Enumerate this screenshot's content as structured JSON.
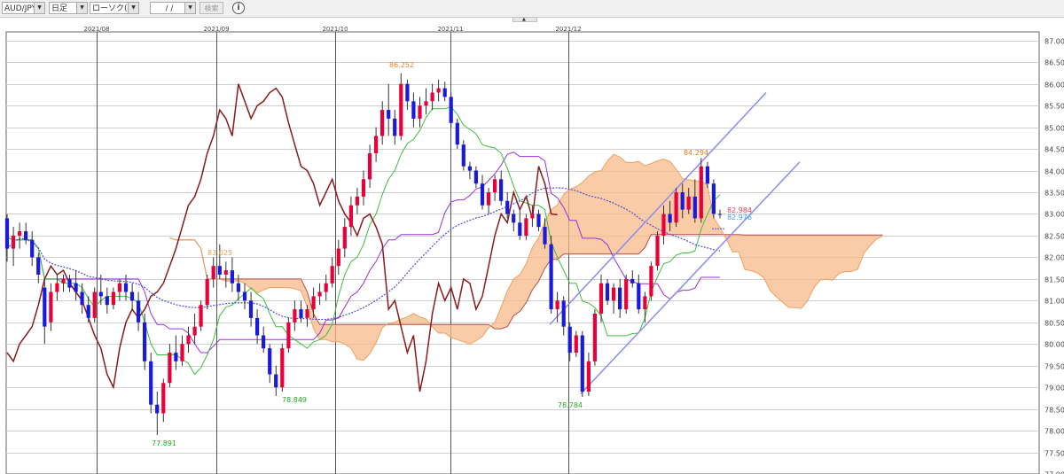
{
  "toolbar": {
    "pair": "AUD/JPY",
    "period": "日足",
    "chart_type": "ローソク(BID)",
    "date": "/ /",
    "search_label": "検索",
    "info_label": "i"
  },
  "chart_data": {
    "type": "candlestick",
    "symbol": "AUD/JPY",
    "ylim": [
      77.0,
      87.2
    ],
    "y_ticks": [
      "77.000",
      "77.500",
      "78.000",
      "78.500",
      "79.000",
      "79.500",
      "80.000",
      "80.500",
      "81.000",
      "81.500",
      "82.000",
      "82.500",
      "83.000",
      "83.500",
      "84.000",
      "84.500",
      "85.000",
      "85.500",
      "86.000",
      "86.500",
      "87.000"
    ],
    "x_months": [
      "2021/08",
      "2021/09",
      "2021/10",
      "2021/11",
      "2021/12"
    ],
    "grid": true,
    "price_labels": {
      "bid": "82.984",
      "ask": "82.976"
    },
    "annotations": [
      "86.252",
      "84.294",
      "83.025",
      "78.849",
      "78.784",
      "77.891"
    ],
    "colors": {
      "up": "#e8003a",
      "down": "#1a1adc",
      "kijun": "#9b30d8",
      "tenkan": "#3cc03c",
      "span_a": "#f0a060",
      "span_b": "#b05050",
      "cloud": "#f7b98a",
      "chikou": "#8b1a1a",
      "ma": "#4d4de0",
      "channel": "#8c8cf0"
    }
  }
}
